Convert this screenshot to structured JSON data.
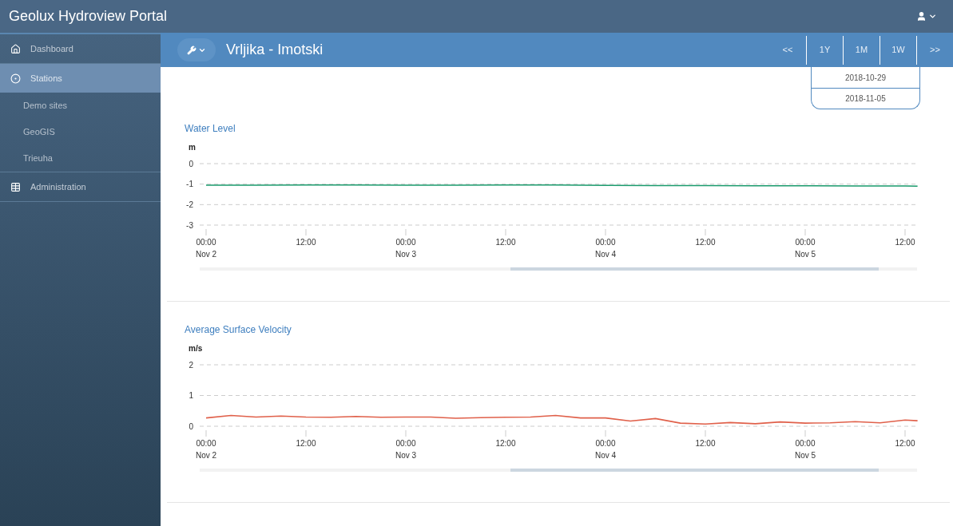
{
  "app": {
    "title": "Geolux Hydroview Portal"
  },
  "sidebar": {
    "items": [
      {
        "label": "Dashboard",
        "selected": false
      },
      {
        "label": "Stations",
        "selected": true,
        "children": [
          {
            "label": "Demo sites",
            "selected": false
          },
          {
            "label": "GeoGIS",
            "selected": false
          },
          {
            "label": "Trieuha",
            "selected": false
          }
        ]
      },
      {
        "label": "Administration",
        "selected": false
      }
    ]
  },
  "header": {
    "station": "Vrljika - Imotski",
    "range_buttons": [
      "<<",
      "1Y",
      "1M",
      "1W",
      ">>"
    ],
    "dates": [
      "2018-10-29",
      "2018-11-05"
    ]
  },
  "charts": [
    {
      "title": "Water Level",
      "chart_data": {
        "type": "line",
        "ylabel": "m",
        "ylim": [
          -3,
          0
        ],
        "yticks": [
          0,
          -1,
          -2,
          -3
        ],
        "xlim": [
          "2018-11-01T23:14",
          "2018-11-05T13:38"
        ],
        "xticks": [
          {
            "value": "2018-11-02T00:00",
            "label": "00:00\nNov 2"
          },
          {
            "value": "2018-11-02T12:00",
            "label": "12:00"
          },
          {
            "value": "2018-11-03T00:00",
            "label": "00:00\nNov 3"
          },
          {
            "value": "2018-11-03T12:00",
            "label": "12:00"
          },
          {
            "value": "2018-11-04T00:00",
            "label": "00:00\nNov 4"
          },
          {
            "value": "2018-11-04T12:00",
            "label": "12:00"
          },
          {
            "value": "2018-11-05T00:00",
            "label": "00:00\nNov 5"
          },
          {
            "value": "2018-11-05T12:00",
            "label": "12:00"
          }
        ],
        "x": [
          "2018-11-02T00:00",
          "2018-11-02T06:00",
          "2018-11-02T12:00",
          "2018-11-02T18:00",
          "2018-11-03T00:00",
          "2018-11-03T06:00",
          "2018-11-03T12:00",
          "2018-11-03T18:00",
          "2018-11-04T00:00",
          "2018-11-04T06:00",
          "2018-11-04T12:00",
          "2018-11-04T18:00",
          "2018-11-05T00:00",
          "2018-11-05T06:00",
          "2018-11-05T12:00",
          "2018-11-05T13:30"
        ],
        "series": [
          {
            "color": "#1a9a6c",
            "values": [
              -1.05,
              -1.05,
              -1.04,
              -1.04,
              -1.05,
              -1.05,
              -1.04,
              -1.04,
              -1.06,
              -1.07,
              -1.07,
              -1.08,
              -1.08,
              -1.09,
              -1.09,
              -1.1
            ]
          }
        ]
      }
    },
    {
      "title": "Average Surface Velocity",
      "chart_data": {
        "type": "line",
        "ylabel": "m/s",
        "ylim": [
          0,
          2
        ],
        "yticks": [
          0,
          1,
          2
        ],
        "xlim": [
          "2018-11-01T23:14",
          "2018-11-05T13:38"
        ],
        "xticks": [
          {
            "value": "2018-11-02T00:00",
            "label": "00:00\nNov 2"
          },
          {
            "value": "2018-11-02T12:00",
            "label": "12:00"
          },
          {
            "value": "2018-11-03T00:00",
            "label": "00:00\nNov 3"
          },
          {
            "value": "2018-11-03T12:00",
            "label": "12:00"
          },
          {
            "value": "2018-11-04T00:00",
            "label": "00:00\nNov 4"
          },
          {
            "value": "2018-11-04T12:00",
            "label": "12:00"
          },
          {
            "value": "2018-11-05T00:00",
            "label": "00:00\nNov 5"
          },
          {
            "value": "2018-11-05T12:00",
            "label": "12:00"
          }
        ],
        "x": [
          "2018-11-02T00:00",
          "2018-11-02T03:00",
          "2018-11-02T06:00",
          "2018-11-02T09:00",
          "2018-11-02T12:00",
          "2018-11-02T15:00",
          "2018-11-02T18:00",
          "2018-11-02T21:00",
          "2018-11-03T00:00",
          "2018-11-03T03:00",
          "2018-11-03T06:00",
          "2018-11-03T09:00",
          "2018-11-03T12:00",
          "2018-11-03T15:00",
          "2018-11-03T18:00",
          "2018-11-03T21:00",
          "2018-11-04T00:00",
          "2018-11-04T03:00",
          "2018-11-04T06:00",
          "2018-11-04T09:00",
          "2018-11-04T12:00",
          "2018-11-04T15:00",
          "2018-11-04T18:00",
          "2018-11-04T21:00",
          "2018-11-05T00:00",
          "2018-11-05T03:00",
          "2018-11-05T06:00",
          "2018-11-05T09:00",
          "2018-11-05T12:00",
          "2018-11-05T13:30"
        ],
        "series": [
          {
            "color": "#e0604a",
            "values": [
              0.27,
              0.35,
              0.3,
              0.33,
              0.3,
              0.29,
              0.32,
              0.29,
              0.3,
              0.3,
              0.26,
              0.28,
              0.29,
              0.3,
              0.35,
              0.27,
              0.27,
              0.17,
              0.25,
              0.1,
              0.07,
              0.12,
              0.08,
              0.14,
              0.1,
              0.11,
              0.15,
              0.11,
              0.2,
              0.18
            ]
          }
        ]
      }
    }
  ]
}
